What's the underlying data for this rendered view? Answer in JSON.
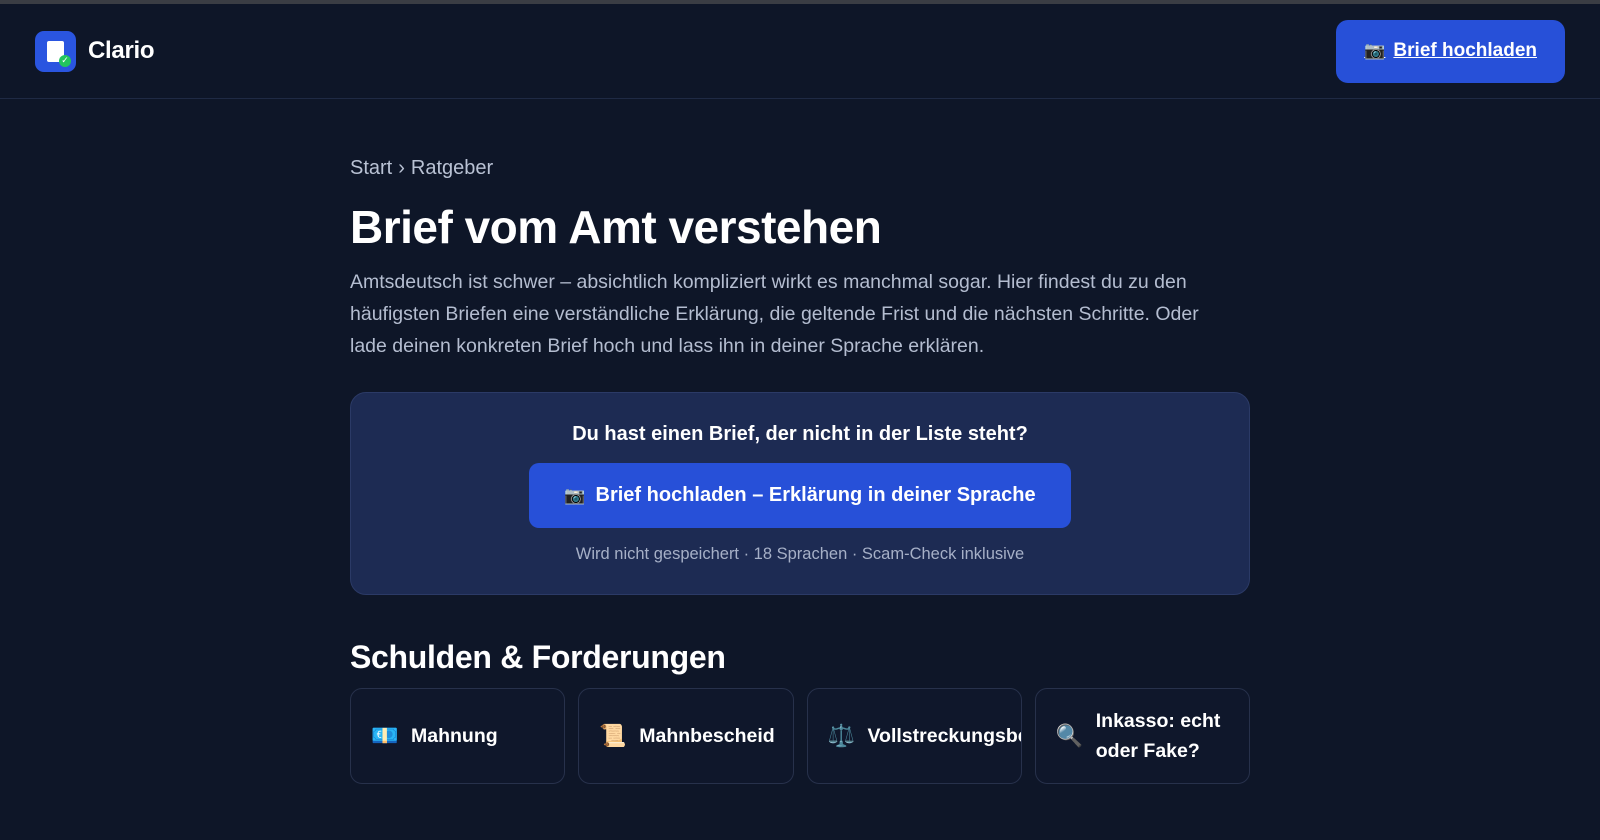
{
  "header": {
    "brand_name": "Clario",
    "upload_label": "Brief hochladen",
    "upload_icon": "📷"
  },
  "breadcrumb": {
    "items": [
      "Start",
      "Ratgeber"
    ],
    "separator": "›"
  },
  "page": {
    "title": "Brief vom Amt verstehen",
    "intro": "Amtsdeutsch ist schwer – absichtlich kompliziert wirkt es manchmal sogar. Hier findest du zu den häufigsten Briefen eine verständliche Erklärung, die geltende Frist und die nächsten Schritte. Oder lade deinen konkreten Brief hoch und lass ihn in deiner Sprache erklären."
  },
  "cta": {
    "title": "Du hast einen Brief, der nicht in der Liste steht?",
    "button_icon": "📷",
    "button_label": "Brief hochladen – Erklärung in deiner Sprache",
    "subtext": "Wird nicht gespeichert · 18 Sprachen · Scam-Check inklusive"
  },
  "section": {
    "title": "Schulden & Forderungen",
    "cards": [
      {
        "icon": "💶",
        "label": "Mahnung"
      },
      {
        "icon": "📜",
        "label": "Mahnbescheid"
      },
      {
        "icon": "⚖️",
        "label": "Vollstreckungsbescheid"
      },
      {
        "icon": "🔍",
        "label": "Inkasso: echt oder Fake?"
      }
    ]
  },
  "colors": {
    "background": "#0e1628",
    "accent": "#2750d8",
    "panel": "#1d2b53"
  }
}
